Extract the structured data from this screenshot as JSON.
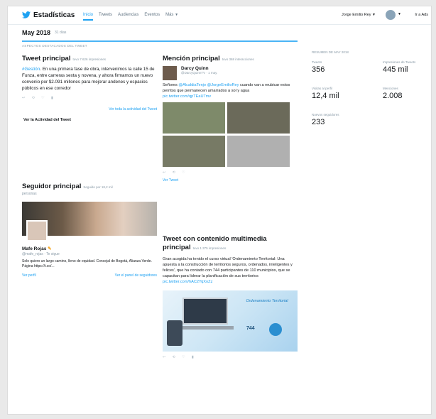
{
  "nav": {
    "brand": "Estadísticas",
    "links": [
      "Inicio",
      "Tweets",
      "Audiencias",
      "Eventos",
      "Más"
    ],
    "user": "Jorge Emilio Rey",
    "ads": "Ir a Ads"
  },
  "period": {
    "title": "May 2018",
    "subtitle": "31 días"
  },
  "highlights_label": "ASPECTOS DESTACADOS DEL TWEET",
  "top_tweet": {
    "title": "Tweet principal",
    "meta": "tuvo 7.626 impresiones",
    "mention": "#Gestión",
    "text": ". En una primera fase de obra, intervenimos la calle 15 de Funza, entre carreras sexta y novena, y ahora firmamos un nuevo convenio por $2.091 millones para mejorar andenes y espacios públicos en ese corredor",
    "view_link": "Ver toda la actividad del Tweet",
    "activity_link": "Ver la Actividad del Tweet"
  },
  "top_mention": {
    "title": "Mención principal",
    "meta": "tuvo 368 interacciones",
    "name": "Darcy Quinn",
    "handle": "@DarcyQuinnTV · 1 may.",
    "text_pre": "Señores ",
    "mention1": "@AlcaldiaTenjo",
    "text_mid": " ",
    "mention2": "@JorgeEmilioRey",
    "text_post": " cuando van a reubicar estos perritos que permanecen amarrados a sol y agua",
    "pic_link": "pic.twitter.com/qpTEaU7mv",
    "view_link": "Ver Tweet"
  },
  "top_follower": {
    "title": "Seguidor principal",
    "meta": "Seguido por 18,2 mil",
    "meta2": "personas",
    "name": "Mafe Rojas",
    "handle": "@mafe_rojas · Te sigue",
    "bio": "Solo quiero un largo camino, lleno de equidad. Concejal de Bogotá, Alianza Verde. Página https://t.co/...",
    "view_link": "Ver perfil",
    "followers_link": "Ver el panel de seguidores"
  },
  "media_tweet": {
    "title": "Tweet con contenido multimedia principal",
    "meta": "tuvo 1.375 impresiones",
    "text": "Gran acogida ha tenido el curso virtual 'Ordenamiento Territorial: Una apuesta a la construcción de territorios seguros, ordenados, inteligentes y felices', que ha contado con 744 participantes de 110 municipios, que se capacitan para liderar la planificación de sus territorios",
    "pic_link": "pic.twitter.com/hAC2YqXoZz",
    "image_caption": "Ordenamiento Territorial",
    "image_number": "744"
  },
  "summary": {
    "title": "RESUMEN DE MAY 2018",
    "stats": [
      {
        "label": "Tweets",
        "value": "356"
      },
      {
        "label": "Impresiones de Tweets",
        "value": "445 mil"
      },
      {
        "label": "Visitas al perfil",
        "value": "12,4 mil"
      },
      {
        "label": "Menciones",
        "value": "2.008"
      },
      {
        "label": "Nuevos seguidores",
        "value": "233"
      }
    ]
  },
  "colors": {
    "accent": "#1da1f2",
    "text": "#14171a",
    "muted": "#8899a6"
  }
}
